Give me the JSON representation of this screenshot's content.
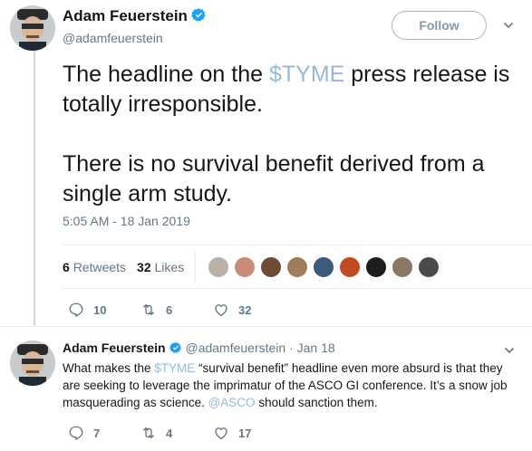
{
  "main_tweet": {
    "author_name": "Adam Feuerstein",
    "handle": "@adamfeuerstein",
    "follow_label": "Follow",
    "text_p1_before": "The headline on the ",
    "text_p1_cashtag": "$TYME",
    "text_p1_after": " press release is totally irresponsible.",
    "text_p2": "There is no survival benefit derived from a single arm study.",
    "timestamp": "5:05 AM - 18 Jan 2019",
    "retweets_count": "6",
    "retweets_label": "Retweets",
    "likes_count": "32",
    "likes_label": "Likes",
    "actions": {
      "replies": "10",
      "retweets": "6",
      "likes": "32"
    }
  },
  "reply_tweet": {
    "author_name": "Adam Feuerstein",
    "meta": "@adamfeuerstein · Jan 18",
    "text_1": "What makes the ",
    "cashtag": "$TYME",
    "text_2": " “survival benefit” headline  even more absurd is that they are seeking to leverage the imprimatur of the ASCO GI conference. It’s a snow job masquerading as science. ",
    "mention": "@ASCO",
    "text_3": " should sanction them.",
    "actions": {
      "replies": "7",
      "retweets": "4",
      "likes": "17"
    }
  },
  "icons": [
    "verified-badge-icon",
    "chevron-down-icon",
    "reply-icon",
    "retweet-icon",
    "like-icon"
  ],
  "colors": {
    "text": "#14171a",
    "muted": "#657786",
    "link": "#97b9d9",
    "verified": "#1da1f2",
    "divider": "#e6ecf0"
  }
}
